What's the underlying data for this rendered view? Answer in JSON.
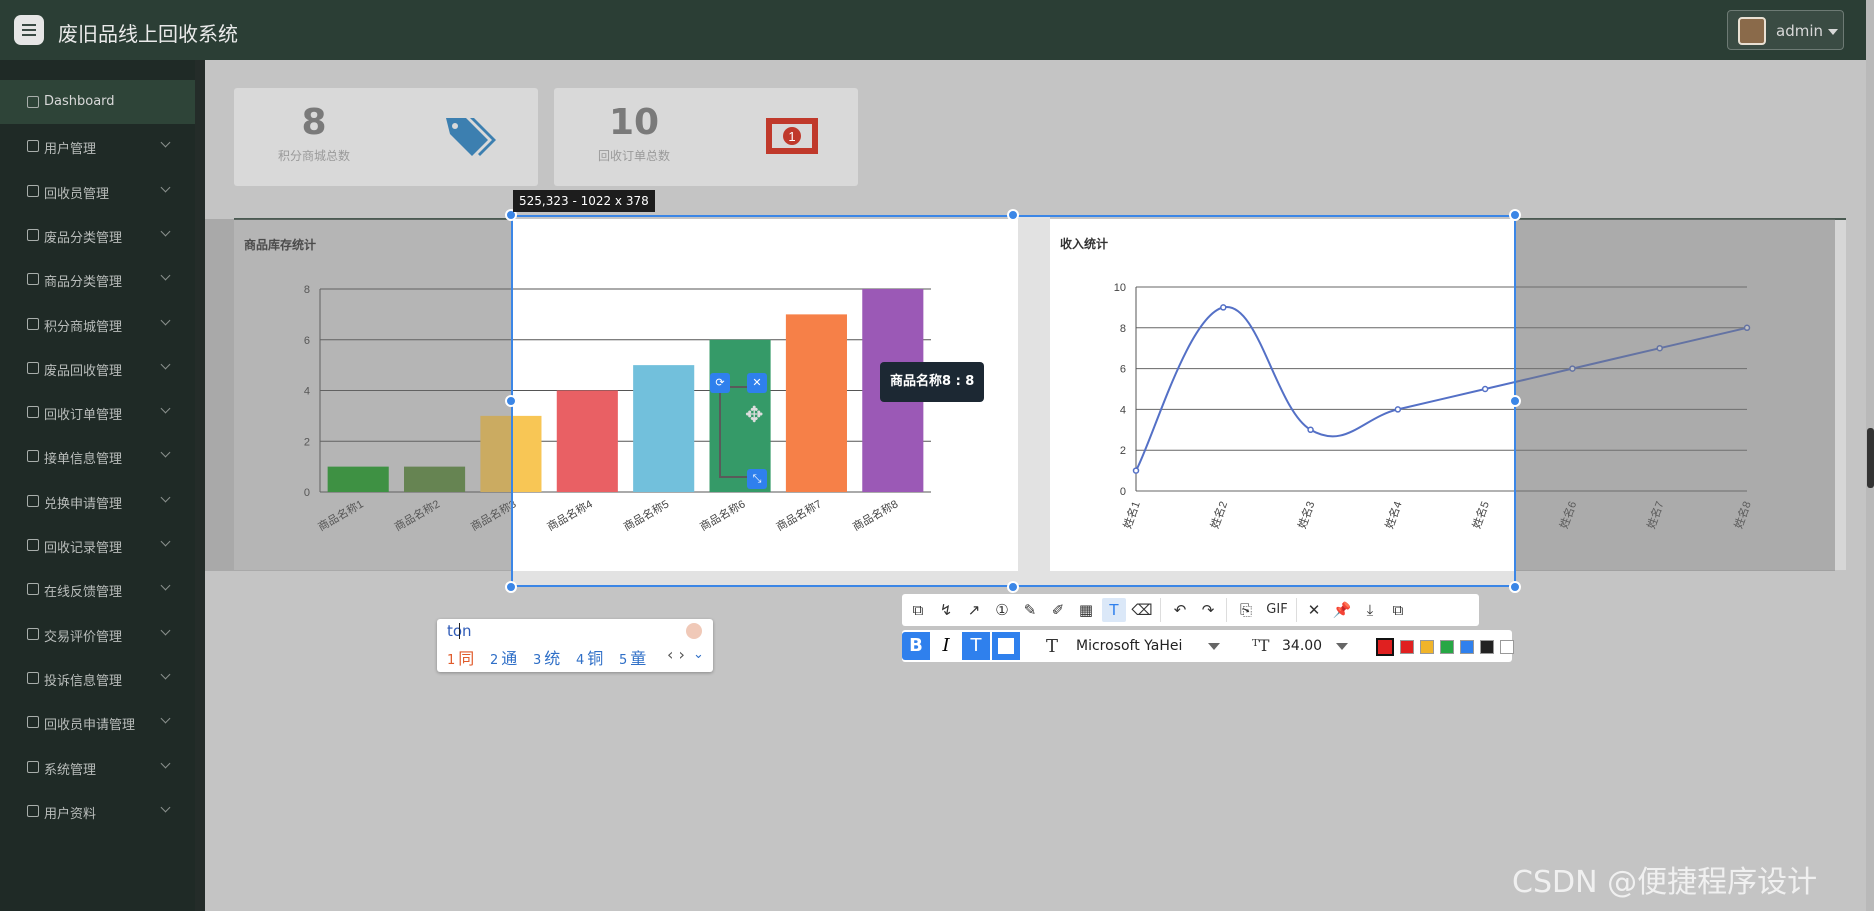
{
  "header": {
    "title": "废旧品线上回收系统",
    "user": "admin"
  },
  "sidebar": {
    "items": [
      {
        "label": "Dashboard",
        "icon": "home-icon"
      },
      {
        "label": "用户管理",
        "icon": "grid-icon"
      },
      {
        "label": "回收员管理",
        "icon": "send-icon"
      },
      {
        "label": "废品分类管理",
        "icon": "truck-icon"
      },
      {
        "label": "商品分类管理",
        "icon": "flag-icon"
      },
      {
        "label": "积分商城管理",
        "icon": "ship-icon"
      },
      {
        "label": "废品回收管理",
        "icon": "grid-icon"
      },
      {
        "label": "回收订单管理",
        "icon": "bar-chart-icon"
      },
      {
        "label": "接单信息管理",
        "icon": "cup-icon"
      },
      {
        "label": "兑换申请管理",
        "icon": "grid-icon"
      },
      {
        "label": "回收记录管理",
        "icon": "pin-icon"
      },
      {
        "label": "在线反馈管理",
        "icon": "grid-icon"
      },
      {
        "label": "交易评价管理",
        "icon": "chart-icon"
      },
      {
        "label": "投诉信息管理",
        "icon": "grid-icon"
      },
      {
        "label": "回收员申请管理",
        "icon": "clipboard-icon"
      },
      {
        "label": "系统管理",
        "icon": "monitor-icon"
      },
      {
        "label": "用户资料",
        "icon": "card-icon"
      }
    ]
  },
  "stats": [
    {
      "value": "8",
      "label": "积分商城总数"
    },
    {
      "value": "10",
      "label": "回收订单总数"
    }
  ],
  "panels": {
    "stock_title": "商品库存统计",
    "income_title": "收入统计"
  },
  "chart_data": [
    {
      "type": "bar",
      "title": "商品库存统计",
      "categories": [
        "商品名称1",
        "商品名称2",
        "商品名称3",
        "商品名称4",
        "商品名称5",
        "商品名称6",
        "商品名称7",
        "商品名称8"
      ],
      "values": [
        1,
        1,
        3,
        4,
        5,
        6,
        7,
        8
      ],
      "colors": [
        "#1f9e27",
        "#5c8a3e",
        "#f8c655",
        "#e96064",
        "#72c0dc",
        "#359a68",
        "#f68048",
        "#9b59b6"
      ],
      "ylim": [
        0,
        8
      ],
      "yticks": [
        0,
        2,
        4,
        6,
        8
      ],
      "grid": true
    },
    {
      "type": "line",
      "title": "收入统计",
      "categories": [
        "姓名1",
        "姓名2",
        "姓名3",
        "姓名4",
        "姓名5",
        "姓名6",
        "姓名7",
        "姓名8"
      ],
      "values": [
        1,
        9,
        3,
        4,
        5,
        6,
        7,
        8
      ],
      "color": "#5470c6",
      "ylim": [
        0,
        10
      ],
      "yticks": [
        0,
        2,
        4,
        6,
        8,
        10
      ],
      "grid": true,
      "smooth": true
    }
  ],
  "selection": {
    "size_label": "525,323 - 1022 x 378"
  },
  "tooltip": {
    "text": "商品名称8 : 8"
  },
  "text_toolbar": {
    "font": "Microsoft YaHei",
    "size": "34.00",
    "colors": [
      "#e02020",
      "#e02020",
      "#f0b429",
      "#27a745",
      "#2f80ed",
      "#222222",
      "#ffffff"
    ]
  },
  "toolbar": {
    "gif_label": "GIF"
  },
  "ime": {
    "input": "ton",
    "candidates": [
      {
        "n": "1",
        "t": "同"
      },
      {
        "n": "2",
        "t": "通"
      },
      {
        "n": "3",
        "t": "统"
      },
      {
        "n": "4",
        "t": "铜"
      },
      {
        "n": "5",
        "t": "童"
      }
    ]
  },
  "watermark": "CSDN @便捷程序设计"
}
